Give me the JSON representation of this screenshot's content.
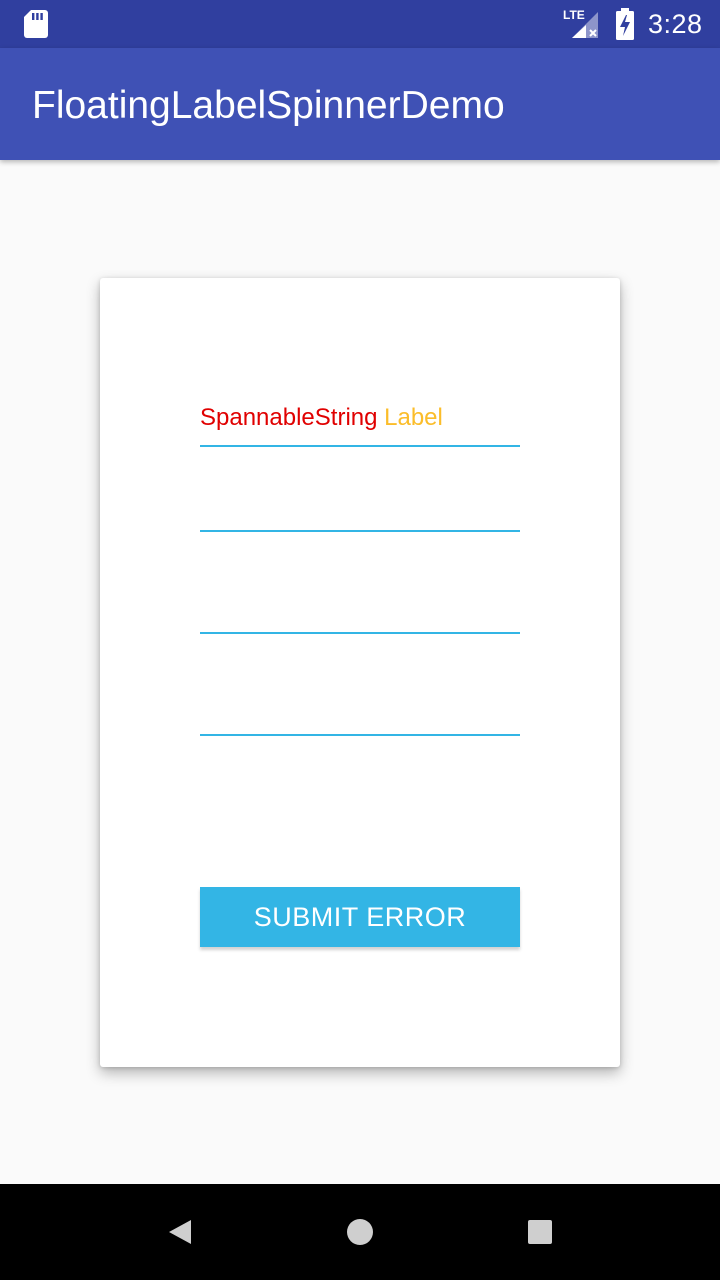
{
  "status_bar": {
    "time": "3:28",
    "network_type": "LTE",
    "icons": [
      "sd-card-icon",
      "lte-signal-icon",
      "battery-charging-icon"
    ]
  },
  "app_bar": {
    "title": "FloatingLabelSpinnerDemo",
    "color": "#3f51b5",
    "status_color": "#303f9f"
  },
  "form": {
    "spinner_label": {
      "red_part": "SpannableString",
      "yellow_part": "Label"
    },
    "spinner_count": 4,
    "accent_color": "#33b5e5",
    "submit_label": "SUBMIT ERROR"
  },
  "nav_bar": {
    "icons": [
      "back-icon",
      "home-icon",
      "recents-icon"
    ]
  }
}
